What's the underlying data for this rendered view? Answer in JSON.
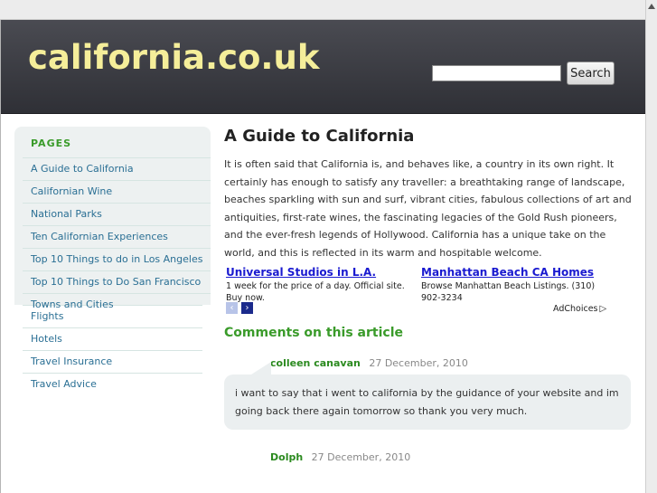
{
  "site": {
    "logo": "california.co.uk",
    "search_placeholder": "",
    "search_button": "Search"
  },
  "sidebar": {
    "heading": "PAGES",
    "items": [
      {
        "label": "A Guide to California"
      },
      {
        "label": "Californian Wine"
      },
      {
        "label": "National Parks"
      },
      {
        "label": "Ten Californian Experiences"
      },
      {
        "label": "Top 10 Things to do in Los Angeles"
      },
      {
        "label": "Top 10 Things to Do San Francisco"
      },
      {
        "label": "Towns and Cities"
      },
      {
        "label": "Flights"
      },
      {
        "label": "Hotels"
      },
      {
        "label": "Travel Insurance"
      },
      {
        "label": "Travel Advice"
      }
    ]
  },
  "article": {
    "title": "A Guide to California",
    "body": "It is often said that California is, and behaves like, a country in its own right. It certainly has enough to satisfy any traveller: a breathtaking range of landscape, beaches sparkling with sun and surf, vibrant cities, fabulous collections of art and antiquities, first-rate wines, the fascinating legacies of the Gold Rush pioneers, and the ever-fresh legends of Hollywood. California has a unique take on the world, and this is reflected in its warm and hospitable welcome."
  },
  "ads": {
    "items": [
      {
        "title": "Universal Studios in L.A.",
        "text": "1 week for the price of a day. Official site. Buy now."
      },
      {
        "title": "Manhattan Beach CA Homes",
        "text": "Browse Manhattan Beach Listings. (310) 902-3234"
      }
    ],
    "prev_glyph": "‹",
    "next_glyph": "›",
    "adchoices_label": "AdChoices",
    "adchoices_icon": "▷"
  },
  "comments": {
    "heading": "Comments on this article",
    "items": [
      {
        "author": "colleen canavan",
        "date": "27 December, 2010",
        "text": "i want to say that i went to california by the guidance of your website and im going back there again tomorrow so thank you very much."
      },
      {
        "author": "Dolph",
        "date": "27 December, 2010",
        "text": ""
      }
    ]
  },
  "colors": {
    "header_bg": "#3a3b41",
    "logo": "#f5ee9a",
    "nav_link": "#2a6f94",
    "heading_green": "#3a9b2a",
    "ad_link": "#1a1ad0",
    "sidebar_bg": "#edf1f1",
    "comment_bg": "#ebeff0"
  }
}
